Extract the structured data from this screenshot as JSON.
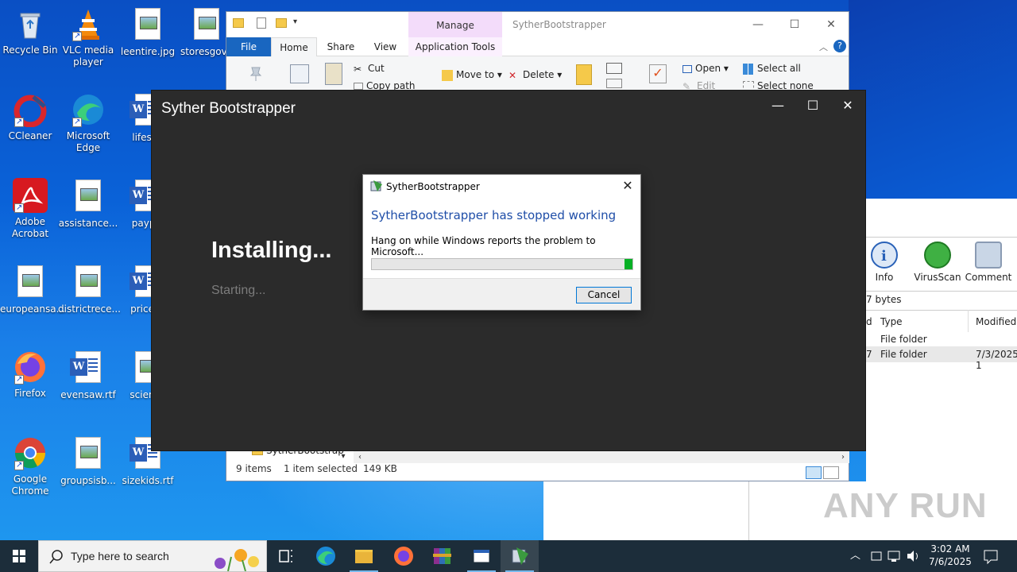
{
  "desktop": {
    "icons": [
      {
        "label": "Recycle Bin"
      },
      {
        "label": "VLC media player"
      },
      {
        "label": "leentire.jpg"
      },
      {
        "label": "storesgove"
      },
      {
        "label": "CCleaner"
      },
      {
        "label": "Microsoft Edge"
      },
      {
        "label": "lifesou"
      },
      {
        "label": "Adobe Acrobat"
      },
      {
        "label": "assistance..."
      },
      {
        "label": "paypal"
      },
      {
        "label": "europeansa..."
      },
      {
        "label": "districtrece..."
      },
      {
        "label": "priceco"
      },
      {
        "label": "Firefox"
      },
      {
        "label": "evensaw.rtf"
      },
      {
        "label": "science"
      },
      {
        "label": "Google Chrome"
      },
      {
        "label": "groupsisb..."
      },
      {
        "label": "sizekids.rtf"
      }
    ]
  },
  "explorer": {
    "manage_tab": "Manage",
    "title": "SytherBootstrapper",
    "tabs": {
      "file": "File",
      "home": "Home",
      "share": "Share",
      "view": "View",
      "app_tools": "Application Tools"
    },
    "ribbon": {
      "cut": "Cut",
      "copy_path": "Copy path",
      "move_to": "Move to",
      "delete": "Delete",
      "open": "Open",
      "edit": "Edit",
      "select_all": "Select all",
      "select_none": "Select none"
    },
    "tree_item": "SytherBootstrap",
    "status": {
      "items": "9 items",
      "selected": "1 item selected",
      "size": "149 KB"
    }
  },
  "anyrun_panel": {
    "tools": [
      {
        "label": "Info"
      },
      {
        "label": "VirusScan"
      },
      {
        "label": "Comment"
      }
    ],
    "size_text": "7 bytes",
    "columns": {
      "d": "d",
      "type": "Type",
      "modified": "Modified"
    },
    "rows": [
      {
        "col0": "",
        "type": "File folder",
        "modified": ""
      },
      {
        "col0": "7",
        "type": "File folder",
        "modified": "7/3/2025 1"
      }
    ]
  },
  "installer": {
    "title": "Syther Bootstrapper",
    "heading": "Installing...",
    "status": "Starting..."
  },
  "dialog": {
    "title": "SytherBootstrapper",
    "heading": "SytherBootstrapper has stopped working",
    "message": "Hang on while Windows reports the problem to Microsoft...",
    "progress": 0.97,
    "cancel": "Cancel"
  },
  "taskbar": {
    "search_placeholder": "Type here to search",
    "time": "3:02 AM",
    "date": "7/6/2025"
  },
  "watermark": "ANY RUN"
}
